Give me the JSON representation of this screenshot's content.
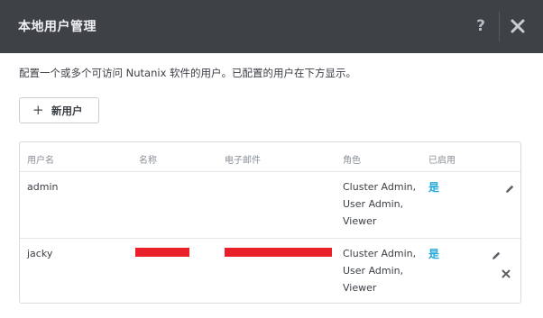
{
  "dialog": {
    "title": "本地用户管理",
    "help_label": "?",
    "description": "配置一个或多个可访问 Nutanix 软件的用户。已配置的用户在下方显示。",
    "new_user_label": "新用户"
  },
  "table": {
    "headers": {
      "username": "用户名",
      "name": "名称",
      "email": "电子邮件",
      "role": "角色",
      "enabled": "已启用"
    },
    "rows": [
      {
        "username": "admin",
        "roles": [
          "Cluster Admin,",
          "User Admin,",
          "Viewer"
        ],
        "enabled": "是"
      },
      {
        "username": "jacky",
        "roles": [
          "Cluster Admin,",
          "User Admin,",
          "Viewer"
        ],
        "enabled": "是"
      }
    ]
  },
  "colors": {
    "header_bg": "#3e4146",
    "accent": "#26a9d8",
    "redaction": "#e8202a"
  },
  "icons": [
    "question-icon",
    "close-icon",
    "plus-icon",
    "edit-pencil-icon",
    "delete-x-icon"
  ]
}
